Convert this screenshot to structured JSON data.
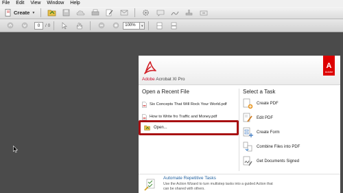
{
  "menubar": {
    "items": [
      "File",
      "Edit",
      "View",
      "Window",
      "Help"
    ]
  },
  "toolbar": {
    "create_label": "Create"
  },
  "navbar": {
    "page_number": "0",
    "page_count": "/ 0",
    "zoom": "100%"
  },
  "welcome": {
    "product_brand": "Adobe",
    "product_rest": " Acrobat  XI Pro",
    "badge_text": "Adobe",
    "recent_title": "Open a Recent File",
    "recent_files": [
      "Six Concepts That Will Rock Your World.pdf",
      "How to Write fro Traffic and Money.pdf"
    ],
    "open_label": "Open...",
    "task_title": "Select a Task",
    "tasks": [
      "Create PDF",
      "Edit PDF",
      "Create Form",
      "Combine Files into PDF",
      "Get Documents Signed"
    ],
    "automate_title": "Automate Repetitive Tasks",
    "automate_body": "Use the Action Wizard to turn multistep tasks into a guided Action that can be shared with others."
  },
  "colors": {
    "accent_red": "#c8102e",
    "highlight_border": "#a80f12",
    "link_blue": "#1f5f9e",
    "doc_bg": "#4b4b4b"
  }
}
